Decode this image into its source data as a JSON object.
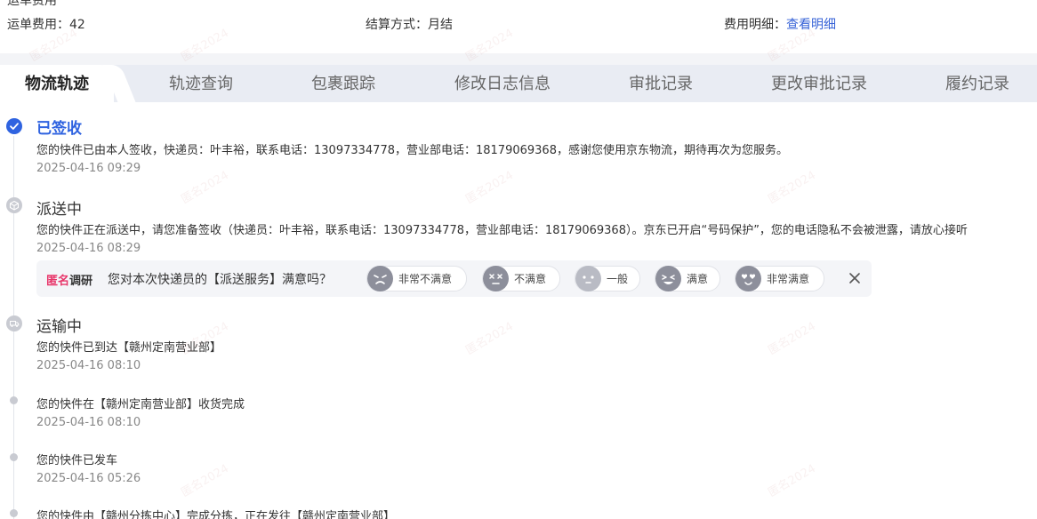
{
  "fee_info": {
    "cut_label": "运单费用",
    "waybill_fee_label": "运单费用：",
    "waybill_fee_value": "42",
    "settlement_label": "结算方式：",
    "settlement_value": "月结",
    "detail_label": "费用明细：",
    "detail_link": "查看明细"
  },
  "tabs": [
    {
      "label": "物流轨迹",
      "active": true
    },
    {
      "label": "轨迹查询",
      "active": false
    },
    {
      "label": "包裹跟踪",
      "active": false
    },
    {
      "label": "修改日志信息",
      "active": false
    },
    {
      "label": "审批记录",
      "active": false
    },
    {
      "label": "更改审批记录",
      "active": false
    },
    {
      "label": "履约记录",
      "active": false
    }
  ],
  "timeline": [
    {
      "status": "已签收",
      "desc": "您的快件已由本人签收，快递员：叶丰裕，联系电话：13097334778，营业部电话：18179069368，感谢您使用京东物流，期待再次为您服务。",
      "time": "2025-04-16 09:29"
    },
    {
      "status": "派送中",
      "desc": "您的快件正在派送中，请您准备签收（快递员：叶丰裕，联系电话：13097334778，营业部电话：18179069368）。京东已开启“号码保护”，您的电话隐私不会被泄露，请放心接听",
      "time": "2025-04-16 08:29"
    },
    {
      "status": "运输中",
      "desc": "您的快件已到达【赣州定南营业部】",
      "time": "2025-04-16 08:10"
    },
    {
      "desc": "您的快件在【赣州定南营业部】收货完成",
      "time": "2025-04-16 08:10"
    },
    {
      "desc": "您的快件已发车",
      "time": "2025-04-16 05:26"
    },
    {
      "desc": "您的快件由【赣州分拣中心】完成分拣，正在发往【赣州定南营业部】"
    }
  ],
  "survey": {
    "brand_part1": "匿名",
    "brand_part2": "调研",
    "question": "您对本次快递员的【派送服务】满意吗？",
    "options": [
      "非常不满意",
      "不满意",
      "一般",
      "满意",
      "非常满意"
    ]
  },
  "watermark": "匿名2024"
}
